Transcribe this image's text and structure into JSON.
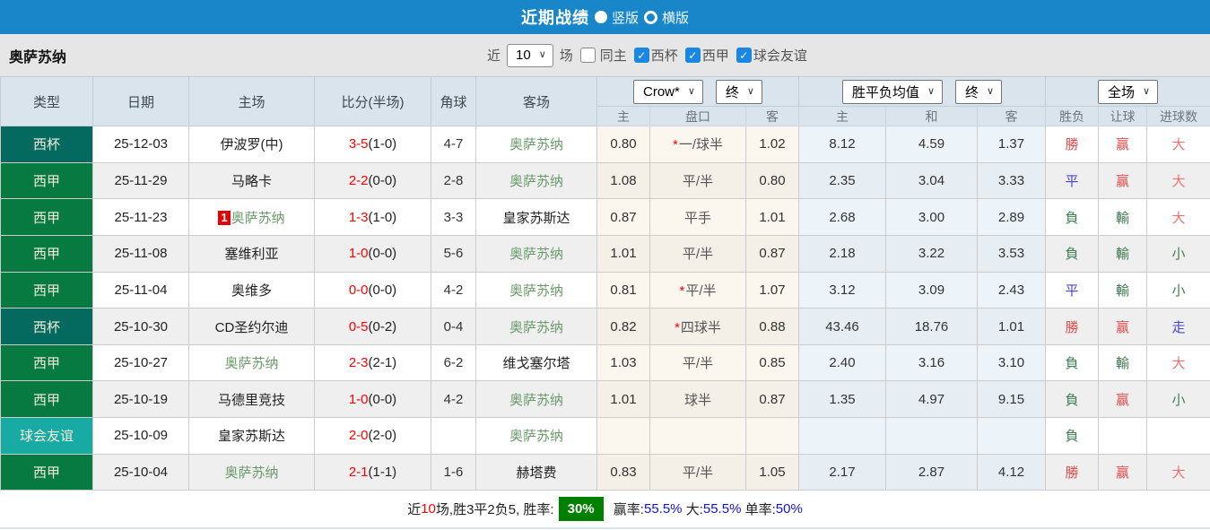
{
  "titlebar": {
    "title": "近期战绩",
    "radios": [
      {
        "label": "竖版",
        "selected": true
      },
      {
        "label": "横版",
        "selected": false
      }
    ]
  },
  "filterbar": {
    "team": "奥萨苏纳",
    "recent_label": "近",
    "recent_value": "10",
    "games_label": "场",
    "check_glyph": "✓",
    "options": [
      {
        "name": "same-home",
        "label": "同主",
        "checked": false
      },
      {
        "name": "west-cup",
        "label": "西杯",
        "checked": true
      },
      {
        "name": "la-liga",
        "label": "西甲",
        "checked": true
      },
      {
        "name": "club-friendly",
        "label": "球会友谊",
        "checked": true
      }
    ]
  },
  "table": {
    "star_mark": "*",
    "columns": {
      "type": "类型",
      "date": "日期",
      "home": "主场",
      "score": "比分(半场)",
      "corner": "角球",
      "away": "客场"
    },
    "selects": {
      "odds_provider": "Crow*",
      "odds_stage": "终",
      "avg_source": "胜平负均值",
      "avg_stage": "终",
      "scope": "全场"
    },
    "sub": [
      "主",
      "盘口",
      "客",
      "主",
      "和",
      "客",
      "胜负",
      "让球",
      "进球数"
    ],
    "rows": [
      {
        "type": "西杯",
        "type_class": "cup",
        "date": "25-12-03",
        "home": {
          "text": "伊波罗(中)",
          "team": false,
          "badge": ""
        },
        "score": "3-5",
        "half": "(1-0)",
        "corner": "4-7",
        "away": {
          "text": "奥萨苏纳",
          "team": true
        },
        "odds": {
          "home": "0.80",
          "star": true,
          "handicap": "一/球半",
          "away": "1.02"
        },
        "avg": {
          "home": "8.12",
          "draw": "4.59",
          "away": "1.37"
        },
        "results": [
          {
            "text": "勝",
            "color": "red"
          },
          {
            "text": "赢",
            "color": "red"
          },
          {
            "text": "大",
            "color": "lightred"
          }
        ]
      },
      {
        "type": "西甲",
        "type_class": "liga",
        "date": "25-11-29",
        "home": {
          "text": "马略卡",
          "team": false,
          "badge": ""
        },
        "score": "2-2",
        "half": "(0-0)",
        "corner": "2-8",
        "away": {
          "text": "奥萨苏纳",
          "team": true
        },
        "odds": {
          "home": "1.08",
          "star": false,
          "handicap": "平/半",
          "away": "0.80"
        },
        "avg": {
          "home": "2.35",
          "draw": "3.04",
          "away": "3.33"
        },
        "results": [
          {
            "text": "平",
            "color": "blue"
          },
          {
            "text": "赢",
            "color": "red"
          },
          {
            "text": "大",
            "color": "lightred"
          }
        ]
      },
      {
        "type": "西甲",
        "type_class": "liga",
        "date": "25-11-23",
        "home": {
          "text": "奥萨苏纳",
          "team": true,
          "badge": "1"
        },
        "score": "1-3",
        "half": "(1-0)",
        "corner": "3-3",
        "away": {
          "text": "皇家苏斯达",
          "team": false
        },
        "odds": {
          "home": "0.87",
          "star": false,
          "handicap": "平手",
          "away": "1.01"
        },
        "avg": {
          "home": "2.68",
          "draw": "3.00",
          "away": "2.89"
        },
        "results": [
          {
            "text": "負",
            "color": "green"
          },
          {
            "text": "輸",
            "color": "green"
          },
          {
            "text": "大",
            "color": "lightred"
          }
        ]
      },
      {
        "type": "西甲",
        "type_class": "liga",
        "date": "25-11-08",
        "home": {
          "text": "塞维利亚",
          "team": false,
          "badge": ""
        },
        "score": "1-0",
        "half": "(0-0)",
        "corner": "5-6",
        "away": {
          "text": "奥萨苏纳",
          "team": true
        },
        "odds": {
          "home": "1.01",
          "star": false,
          "handicap": "平/半",
          "away": "0.87"
        },
        "avg": {
          "home": "2.18",
          "draw": "3.22",
          "away": "3.53"
        },
        "results": [
          {
            "text": "負",
            "color": "green"
          },
          {
            "text": "輸",
            "color": "green"
          },
          {
            "text": "小",
            "color": "green"
          }
        ]
      },
      {
        "type": "西甲",
        "type_class": "liga",
        "date": "25-11-04",
        "home": {
          "text": "奥维多",
          "team": false,
          "badge": ""
        },
        "score": "0-0",
        "half": "(0-0)",
        "corner": "4-2",
        "away": {
          "text": "奥萨苏纳",
          "team": true
        },
        "odds": {
          "home": "0.81",
          "star": true,
          "handicap": "平/半",
          "away": "1.07"
        },
        "avg": {
          "home": "3.12",
          "draw": "3.09",
          "away": "2.43"
        },
        "results": [
          {
            "text": "平",
            "color": "blue"
          },
          {
            "text": "輸",
            "color": "green"
          },
          {
            "text": "小",
            "color": "green"
          }
        ]
      },
      {
        "type": "西杯",
        "type_class": "cup",
        "date": "25-10-30",
        "home": {
          "text": "CD圣约尔迪",
          "team": false,
          "badge": ""
        },
        "score": "0-5",
        "half": "(0-2)",
        "corner": "0-4",
        "away": {
          "text": "奥萨苏纳",
          "team": true
        },
        "odds": {
          "home": "0.82",
          "star": true,
          "handicap": "四球半",
          "away": "0.88"
        },
        "avg": {
          "home": "43.46",
          "draw": "18.76",
          "away": "1.01"
        },
        "results": [
          {
            "text": "勝",
            "color": "red"
          },
          {
            "text": "赢",
            "color": "red"
          },
          {
            "text": "走",
            "color": "blue"
          }
        ]
      },
      {
        "type": "西甲",
        "type_class": "liga",
        "date": "25-10-27",
        "home": {
          "text": "奥萨苏纳",
          "team": true,
          "badge": ""
        },
        "score": "2-3",
        "half": "(2-1)",
        "corner": "6-2",
        "away": {
          "text": "维戈塞尔塔",
          "team": false
        },
        "odds": {
          "home": "1.03",
          "star": false,
          "handicap": "平/半",
          "away": "0.85"
        },
        "avg": {
          "home": "2.40",
          "draw": "3.16",
          "away": "3.10"
        },
        "results": [
          {
            "text": "負",
            "color": "green"
          },
          {
            "text": "輸",
            "color": "green"
          },
          {
            "text": "大",
            "color": "lightred"
          }
        ]
      },
      {
        "type": "西甲",
        "type_class": "liga",
        "date": "25-10-19",
        "home": {
          "text": "马德里竞技",
          "team": false,
          "badge": ""
        },
        "score": "1-0",
        "half": "(0-0)",
        "corner": "4-2",
        "away": {
          "text": "奥萨苏纳",
          "team": true
        },
        "odds": {
          "home": "1.01",
          "star": false,
          "handicap": "球半",
          "away": "0.87"
        },
        "avg": {
          "home": "1.35",
          "draw": "4.97",
          "away": "9.15"
        },
        "results": [
          {
            "text": "負",
            "color": "green"
          },
          {
            "text": "赢",
            "color": "red"
          },
          {
            "text": "小",
            "color": "green"
          }
        ]
      },
      {
        "type": "球会友谊",
        "type_class": "friendly",
        "date": "25-10-09",
        "home": {
          "text": "皇家苏斯达",
          "team": false,
          "badge": ""
        },
        "score": "2-0",
        "half": "(2-0)",
        "corner": "",
        "away": {
          "text": "奥萨苏纳",
          "team": true
        },
        "odds": {
          "home": "",
          "star": false,
          "handicap": "",
          "away": ""
        },
        "avg": {
          "home": "",
          "draw": "",
          "away": ""
        },
        "results": [
          {
            "text": "負",
            "color": "green"
          },
          {
            "text": "",
            "color": null
          },
          {
            "text": "",
            "color": null
          }
        ]
      },
      {
        "type": "西甲",
        "type_class": "liga",
        "date": "25-10-04",
        "home": {
          "text": "奥萨苏纳",
          "team": true,
          "badge": ""
        },
        "score": "2-1",
        "half": "(1-1)",
        "corner": "1-6",
        "away": {
          "text": "赫塔费",
          "team": false
        },
        "odds": {
          "home": "0.83",
          "star": false,
          "handicap": "平/半",
          "away": "1.05"
        },
        "avg": {
          "home": "2.17",
          "draw": "2.87",
          "away": "4.12"
        },
        "results": [
          {
            "text": "勝",
            "color": "red"
          },
          {
            "text": "赢",
            "color": "red"
          },
          {
            "text": "大",
            "color": "lightred"
          }
        ]
      }
    ]
  },
  "summary": {
    "segments": [
      {
        "text": "近",
        "style": "plain"
      },
      {
        "text": "10",
        "style": "red"
      },
      {
        "text": "场,胜3平2负5, 胜率:",
        "style": "plain"
      },
      {
        "text": "30%",
        "style": "badge"
      },
      {
        "text": " 赢率:",
        "style": "plain"
      },
      {
        "text": "55.5%",
        "style": "blue"
      },
      {
        "text": " 大:",
        "style": "plain"
      },
      {
        "text": "55.5%",
        "style": "blue"
      },
      {
        "text": " 单率:",
        "style": "plain"
      },
      {
        "text": "50%",
        "style": "blue"
      }
    ]
  }
}
